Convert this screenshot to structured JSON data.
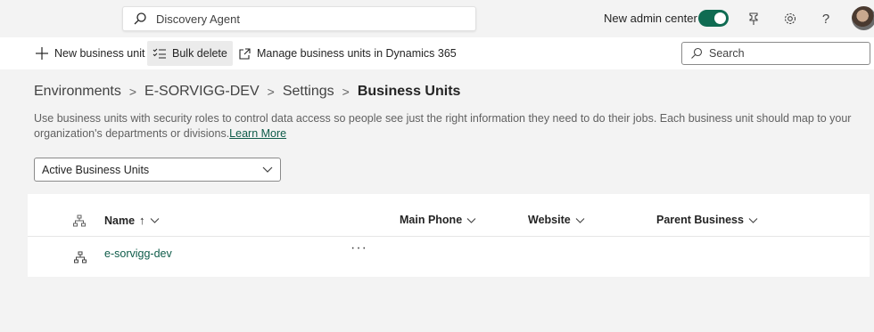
{
  "header": {
    "search_placeholder": "Discovery Agent",
    "admin_toggle_label": "New admin center",
    "admin_toggle_on": true
  },
  "commandbar": {
    "new_label": "New business unit",
    "bulk_label": "Bulk delete",
    "manage_label": "Manage business units in Dynamics 365",
    "search_placeholder": "Search"
  },
  "breadcrumb": [
    "Environments",
    "E-SORVIGG-DEV",
    "Settings",
    "Business Units"
  ],
  "description": "Use business units with security roles to control data access so people see just the right information they need to do their jobs. Each business unit should map to your organization's departments or divisions.",
  "learn_more": "Learn More",
  "filter": {
    "selected": "Active Business Units"
  },
  "grid": {
    "columns": [
      "Name",
      "Main Phone",
      "Website",
      "Parent Business"
    ],
    "sort_arrow": "↑",
    "rows": [
      {
        "name": "e-sorvigg-dev",
        "more": "···"
      }
    ]
  }
}
